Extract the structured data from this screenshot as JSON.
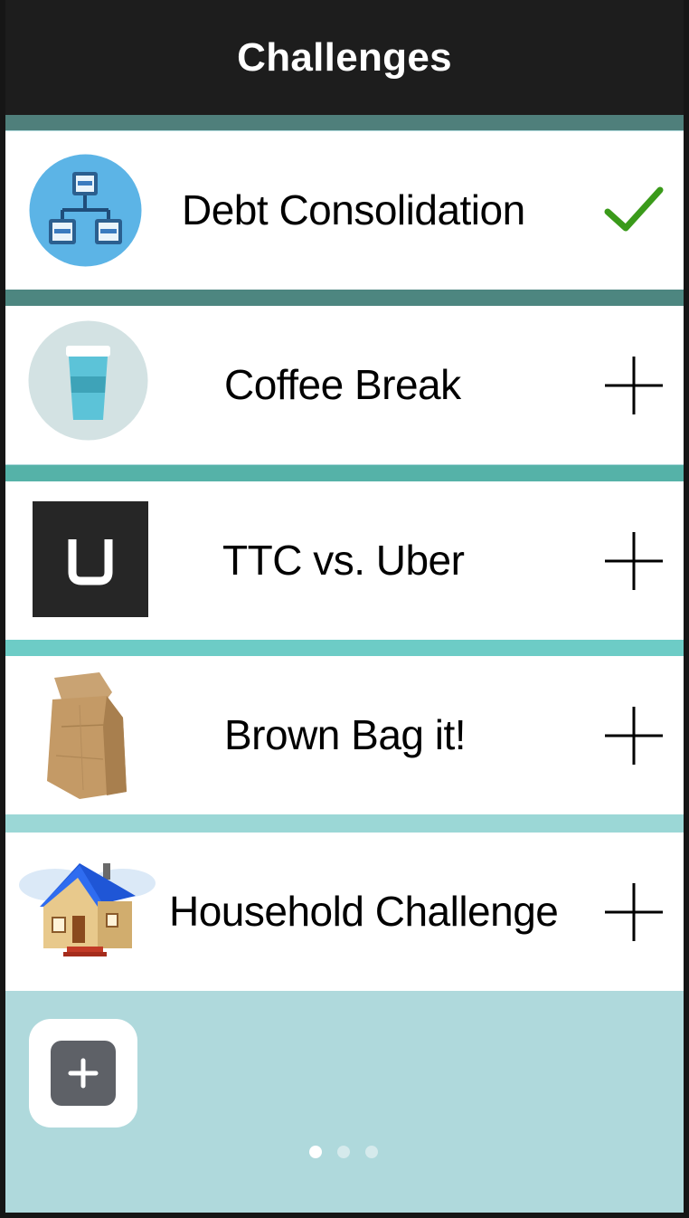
{
  "header": {
    "title": "Challenges"
  },
  "challenges": [
    {
      "label": "Debt Consolidation",
      "icon": "network-diagram-icon",
      "status": "completed",
      "status_icon": "checkmark-icon"
    },
    {
      "label": "Coffee Break",
      "icon": "coffee-cup-icon",
      "status": "available",
      "status_icon": "plus-icon"
    },
    {
      "label": "TTC vs. Uber",
      "icon": "uber-logo-icon",
      "status": "available",
      "status_icon": "plus-icon"
    },
    {
      "label": "Brown Bag it!",
      "icon": "paper-bag-icon",
      "status": "available",
      "status_icon": "plus-icon"
    },
    {
      "label": "Household Challenge",
      "icon": "house-icon",
      "status": "available",
      "status_icon": "plus-icon"
    }
  ],
  "footer": {
    "add_button_icon": "plus-icon",
    "page_indicator": {
      "pages": 3,
      "current": 1
    }
  },
  "colors": {
    "header_bg": "#1d1d1d",
    "separators": [
      "#4f7f7b",
      "#4d8680",
      "#55b2a8",
      "#6dccc6",
      "#9bd7d6"
    ],
    "footer_bg": "#afd9dc",
    "check_green": "#3a9a1a"
  }
}
